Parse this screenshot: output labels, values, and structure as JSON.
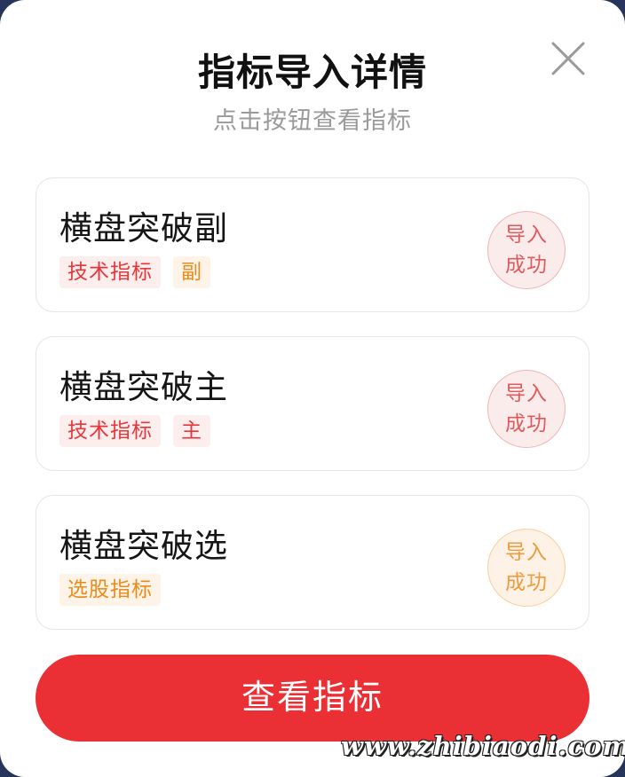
{
  "dialog": {
    "title": "指标导入详情",
    "subtitle": "点击按钮查看指标",
    "close_icon": "close-icon"
  },
  "indicators": [
    {
      "name": "横盘突破副",
      "tags": [
        "技术指标",
        "副"
      ],
      "tag_colors": [
        "red",
        "orange"
      ],
      "status_line1": "导入",
      "status_line2": "成功",
      "status_color": "red"
    },
    {
      "name": "横盘突破主",
      "tags": [
        "技术指标",
        "主"
      ],
      "tag_colors": [
        "red",
        "red"
      ],
      "status_line1": "导入",
      "status_line2": "成功",
      "status_color": "red"
    },
    {
      "name": "横盘突破选",
      "tags": [
        "选股指标"
      ],
      "tag_colors": [
        "orange"
      ],
      "status_line1": "导入",
      "status_line2": "成功",
      "status_color": "orange"
    }
  ],
  "actions": {
    "view_label": "查看指标"
  },
  "watermark": "www.zhibiaodi.com",
  "colors": {
    "primary": "#ea2f35",
    "tag_red": "#e5373b",
    "tag_orange": "#ec8a1c"
  }
}
